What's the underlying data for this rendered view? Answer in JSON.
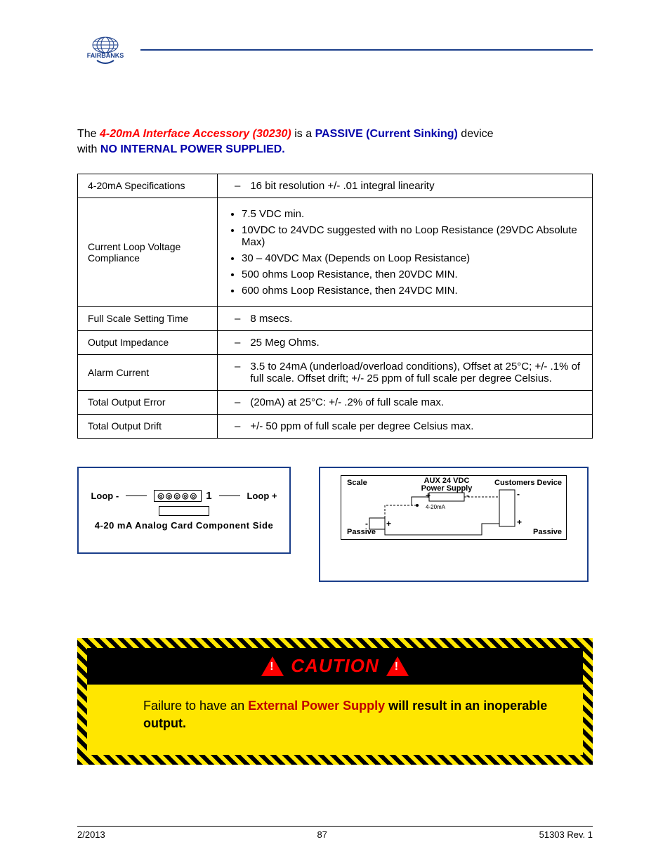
{
  "logo_text": "FAIRBANKS",
  "intro": {
    "p1a": "The ",
    "p1b": "4-20mA Interface Accessory (30230)",
    "p1c": " is a ",
    "p1d": "PASSIVE (Current Sinking)",
    "p1e": " device",
    "p2a": "with ",
    "p2b": "NO INTERNAL POWER SUPPLIED."
  },
  "rows": [
    {
      "label": "4-20mA Specifications",
      "type": "dash",
      "text": "16 bit resolution +/- .01 integral linearity"
    },
    {
      "label": "Current Loop Voltage Compliance",
      "type": "bul",
      "items": [
        "7.5 VDC min.",
        "10VDC to 24VDC suggested with no Loop Resistance (29VDC Absolute Max)",
        "30 – 40VDC Max (Depends on Loop Resistance)",
        "500 ohms Loop Resistance, then 20VDC MIN.",
        "600 ohms Loop Resistance, then 24VDC MIN."
      ]
    },
    {
      "label": "Full Scale Setting Time",
      "type": "dash",
      "text": "8 msecs."
    },
    {
      "label": "Output Impedance",
      "type": "dash",
      "text": "25 Meg Ohms."
    },
    {
      "label": "Alarm Current",
      "type": "dash",
      "text": "3.5 to 24mA (underload/overload conditions), Offset at 25°C; +/- .1% of full scale. Offset drift; +/- 25 ppm of full scale per degree Celsius."
    },
    {
      "label": "Total Output Error",
      "type": "dash",
      "text": "(20mA) at 25°C: +/- .2% of full scale max."
    },
    {
      "label": "Total Output Drift",
      "type": "dash",
      "text": "+/- 50 ppm of full scale per degree Celsius max."
    }
  ],
  "figA": {
    "loop_minus": "Loop -",
    "loop_plus": "Loop +",
    "pins": "◎◎◎◎◎",
    "num": "1",
    "caption": "4-20 mA Analog Card  Component Side"
  },
  "figB": {
    "scale": "Scale",
    "ps": "AUX 24 VDC Power Supply",
    "cust": "Customers Device",
    "mid": "4-20mA",
    "pasL": "Passive",
    "pasR": "Passive"
  },
  "caution": {
    "title": "CAUTION",
    "b1": "Failure to have an ",
    "b2": "External Power Supply",
    "b3": " will result in an inoperable output."
  },
  "footer": {
    "left": "2/2013",
    "center": "87",
    "right": "51303     Rev. 1"
  }
}
